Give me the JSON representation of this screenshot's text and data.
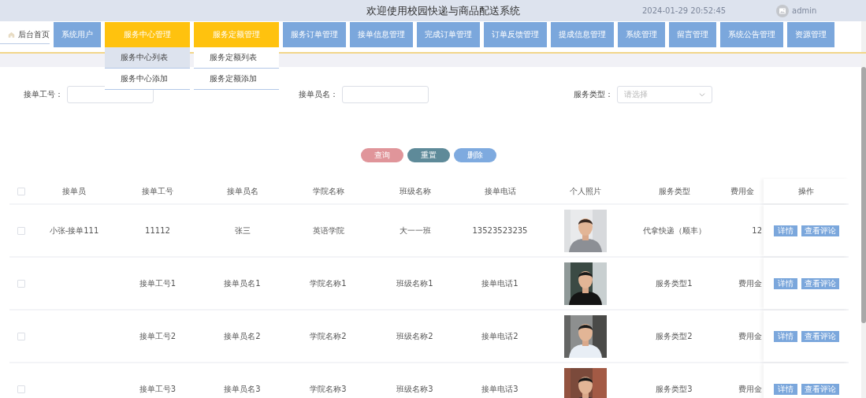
{
  "header": {
    "title": "欢迎使用校园快递与商品配送系统",
    "datetime": "2024-01-29 20:52:45",
    "user": "admin"
  },
  "nav": [
    {
      "kind": "home",
      "label": "后台首页"
    },
    {
      "kind": "menu",
      "label": "系统用户",
      "expanded": false
    },
    {
      "kind": "menu",
      "label": "服务中心管理",
      "expanded": true,
      "submenu": [
        {
          "label": "服务中心列表",
          "selected": true
        },
        {
          "label": "服务中心添加",
          "selected": false
        }
      ]
    },
    {
      "kind": "menu",
      "label": "服务定额管理",
      "expanded": true,
      "submenu": [
        {
          "label": "服务定额列表",
          "selected": false
        },
        {
          "label": "服务定额添加",
          "selected": false
        }
      ]
    },
    {
      "kind": "menu",
      "label": "服务订单管理",
      "expanded": false
    },
    {
      "kind": "menu",
      "label": "接单信息管理",
      "expanded": false
    },
    {
      "kind": "menu",
      "label": "完成订单管理",
      "expanded": false
    },
    {
      "kind": "menu",
      "label": "订单反馈管理",
      "expanded": false
    },
    {
      "kind": "menu",
      "label": "提成信息管理",
      "expanded": false
    },
    {
      "kind": "menu",
      "label": "系统管理",
      "expanded": false
    },
    {
      "kind": "menu",
      "label": "留言管理",
      "expanded": false
    },
    {
      "kind": "menu",
      "label": "系统公告管理",
      "expanded": false
    },
    {
      "kind": "menu",
      "label": "资源管理",
      "expanded": false
    }
  ],
  "search": {
    "fields": [
      {
        "kind": "text",
        "label": "接单工号："
      },
      {
        "kind": "text",
        "label": "接单员名："
      },
      {
        "kind": "select",
        "label": "服务类型：",
        "placeholder": "请选择"
      }
    ]
  },
  "actions": [
    {
      "kind": "search",
      "label": "查询"
    },
    {
      "kind": "reset",
      "label": "重置"
    },
    {
      "kind": "delete",
      "label": "删除"
    }
  ],
  "table": {
    "select_all_checked": false,
    "action_header": "操作",
    "columns": [
      {
        "kind": "text",
        "label": "接单员"
      },
      {
        "kind": "text",
        "label": "接单工号"
      },
      {
        "kind": "text",
        "label": "接单员名"
      },
      {
        "kind": "text",
        "label": "学院名称"
      },
      {
        "kind": "text",
        "label": "班级名称"
      },
      {
        "kind": "text",
        "label": "接单电话"
      },
      {
        "label": "个人照片"
      },
      {
        "kind": "text",
        "label": "服务类型"
      },
      {
        "kind": "text",
        "label": "费用金"
      }
    ],
    "rows": [
      {
        "checked": false,
        "cells": [
          "小张-接单111",
          "11112",
          "张三",
          "英语学院",
          "大一一班",
          "13523523235",
          {
            "kind": "picture"
          },
          "代拿快递（顺丰）",
          "12"
        ],
        "actions": [
          "详情",
          "查看评论"
        ]
      },
      {
        "checked": false,
        "cells": [
          null,
          "接单工号1",
          "接单员名1",
          "学院名称1",
          "班级名称1",
          "接单电话1",
          {
            "kind": "picture"
          },
          "服务类型1",
          "费用金"
        ],
        "actions": [
          "详情",
          "查看评论"
        ]
      },
      {
        "checked": false,
        "cells": [
          null,
          "接单工号2",
          "接单员名2",
          "学院名称2",
          "班级名称2",
          "接单电话2",
          {
            "kind": "picture"
          },
          "服务类型2",
          "费用金"
        ],
        "actions": [
          "详情",
          "查看评论"
        ]
      },
      {
        "checked": false,
        "cells": [
          null,
          "接单工号3",
          "接单员名3",
          "学院名称3",
          "班级名称3",
          "接单电话3",
          {
            "kind": "picture"
          },
          "服务类型3",
          "费用金"
        ],
        "actions": [
          "详情",
          "查看评论"
        ]
      }
    ]
  }
}
